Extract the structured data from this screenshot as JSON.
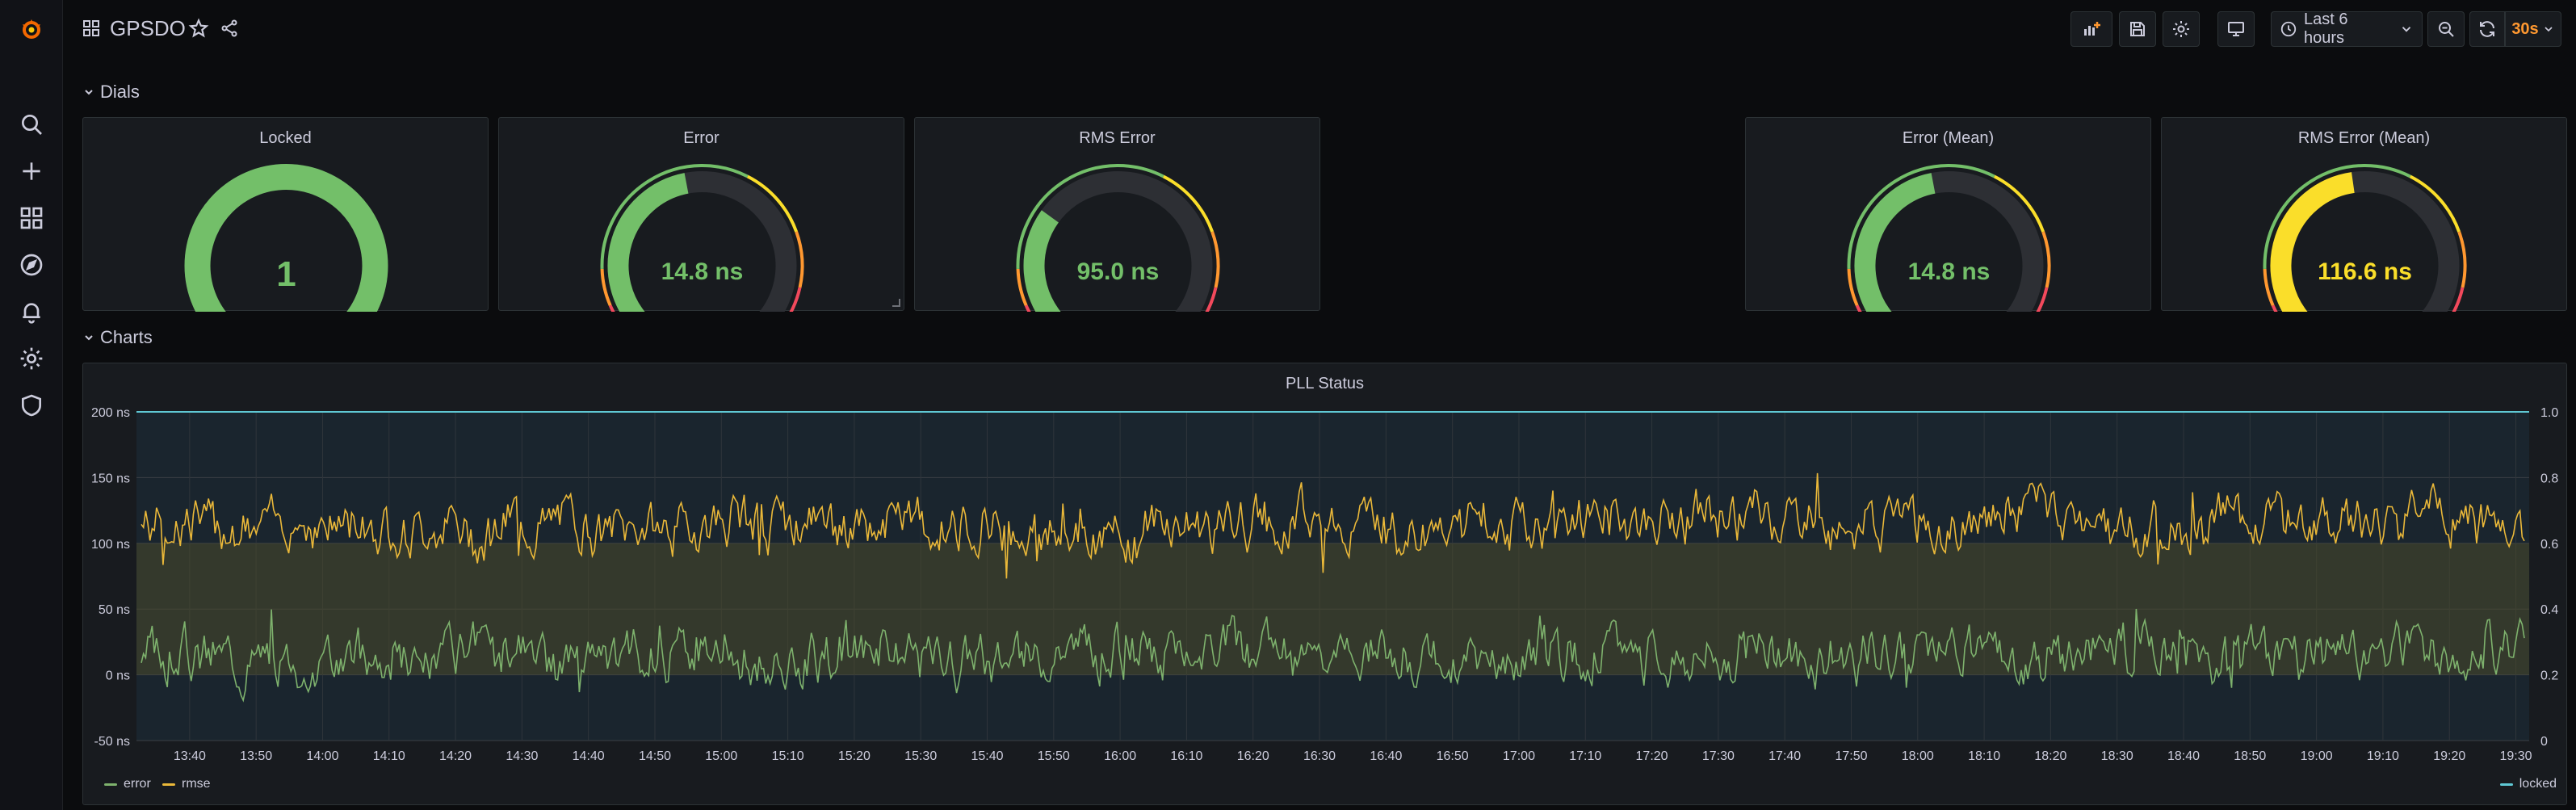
{
  "dashboard": {
    "title": "GPSDO",
    "time_range_label": "Last 6 hours",
    "refresh_interval": "30s"
  },
  "colors": {
    "green": "#73bf69",
    "yellow": "#fade2a",
    "orange": "#ff9830",
    "red": "#f2495c",
    "accent_orange": "#ff9830",
    "cyan": "#5fc8d4",
    "rmse": "#eab839",
    "error": "#7eb26d"
  },
  "rows": {
    "dials_label": "Dials",
    "charts_label": "Charts"
  },
  "gauges": [
    {
      "title": "Locked",
      "display": "1",
      "fraction": 1.0,
      "value_color": "#73bf69",
      "fill_color": "#73bf69",
      "show_thresholds": false
    },
    {
      "title": "Error",
      "display": "14.8 ns",
      "fraction": 0.46,
      "value_color": "#73bf69",
      "fill_color": "#73bf69",
      "show_thresholds": true
    },
    {
      "title": "RMS Error",
      "display": "95.0 ns",
      "fraction": 0.3,
      "value_color": "#73bf69",
      "fill_color": "#73bf69",
      "show_thresholds": true
    },
    {
      "title": "Error (Mean)",
      "display": "14.8 ns",
      "fraction": 0.46,
      "value_color": "#73bf69",
      "fill_color": "#73bf69",
      "show_thresholds": true
    },
    {
      "title": "RMS Error (Mean)",
      "display": "116.6 ns",
      "fraction": 0.47,
      "value_color": "#fade2a",
      "fill_color": "#fade2a",
      "show_thresholds": true
    }
  ],
  "chart_data": {
    "type": "line",
    "title": "PLL Status",
    "y_left": {
      "ticks": [
        "200 ns",
        "150 ns",
        "100 ns",
        "50 ns",
        "0 ns",
        "-50 ns"
      ],
      "range": [
        -50,
        200
      ]
    },
    "y_right": {
      "ticks": [
        "1.0",
        "0.8",
        "0.6",
        "0.4",
        "0.2",
        "0"
      ],
      "range": [
        0,
        1
      ]
    },
    "x_ticks": [
      "13:40",
      "13:50",
      "14:00",
      "14:10",
      "14:20",
      "14:30",
      "14:40",
      "14:50",
      "15:00",
      "15:10",
      "15:20",
      "15:30",
      "15:40",
      "15:50",
      "16:00",
      "16:10",
      "16:20",
      "16:30",
      "16:40",
      "16:50",
      "17:00",
      "17:10",
      "17:20",
      "17:30",
      "17:40",
      "17:50",
      "18:00",
      "18:10",
      "18:20",
      "18:30",
      "18:40",
      "18:50",
      "19:00",
      "19:10",
      "19:20",
      "19:30"
    ],
    "x_range": [
      "13:32",
      "19:32"
    ],
    "grid": true,
    "legend_left": [
      "error",
      "rmse"
    ],
    "legend_right": [
      "locked"
    ],
    "series": [
      {
        "name": "rmse",
        "axis": "left",
        "mean": 115,
        "amplitude": 18,
        "seed": 7
      },
      {
        "name": "error",
        "axis": "left",
        "mean": 15,
        "amplitude": 18,
        "seed": 3
      },
      {
        "name": "locked",
        "axis": "right",
        "constant": 1.0
      }
    ]
  }
}
